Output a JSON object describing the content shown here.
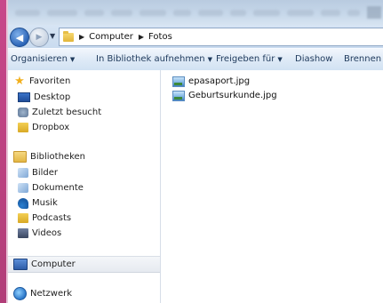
{
  "breadcrumb": {
    "items": [
      "Computer",
      "Fotos"
    ]
  },
  "toolbar": {
    "organize": "Organisieren",
    "library": "In Bibliothek aufnehmen",
    "share": "Freigeben für",
    "slideshow": "Diashow",
    "burn": "Brennen"
  },
  "nav": {
    "favorites": "Favoriten",
    "desktop": "Desktop",
    "recent": "Zuletzt besucht",
    "dropbox": "Dropbox",
    "libraries": "Bibliotheken",
    "pictures": "Bilder",
    "documents": "Dokumente",
    "music": "Musik",
    "podcasts": "Podcasts",
    "videos": "Videos",
    "computer": "Computer",
    "network": "Netzwerk"
  },
  "files": [
    {
      "name": "epasaport.jpg"
    },
    {
      "name": "Geburtsurkunde.jpg"
    }
  ],
  "colors": {
    "window_edge": "#c8478a",
    "toolbar_text": "#1e395b",
    "selected_bg": "#e6eaf0"
  }
}
